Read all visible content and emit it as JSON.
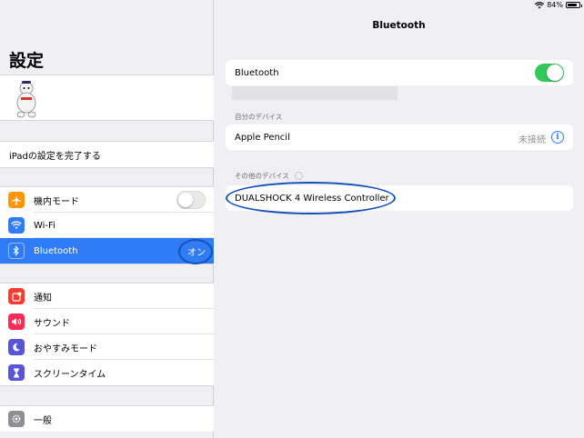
{
  "status_bar": {
    "battery": "84%",
    "battery_level": 0.84
  },
  "sidebar": {
    "title": "設定",
    "setup_prompt": "iPadの設定を完了する",
    "items_network": [
      {
        "label": "機内モード",
        "icon": "airplane-icon",
        "color": "#ff9500"
      },
      {
        "label": "Wi-Fi",
        "icon": "wifi-icon",
        "color": "#2f7cf6"
      },
      {
        "label": "Bluetooth",
        "icon": "bluetooth-icon",
        "color": "#2f7cf6",
        "value": "オン"
      }
    ],
    "items_notify": [
      {
        "label": "通知",
        "icon": "notifications-icon",
        "color": "#ff3b30"
      },
      {
        "label": "サウンド",
        "icon": "sound-icon",
        "color": "#ff2d55"
      },
      {
        "label": "おやすみモード",
        "icon": "moon-icon",
        "color": "#5856d6"
      },
      {
        "label": "スクリーンタイム",
        "icon": "hourglass-icon",
        "color": "#5856d6"
      }
    ],
    "items_general": [
      {
        "label": "一般",
        "icon": "gear-icon",
        "color": "#8e8e93"
      }
    ]
  },
  "detail": {
    "title": "Bluetooth",
    "bluetooth_label": "Bluetooth",
    "bluetooth_on": true,
    "my_devices_header": "自分のデバイス",
    "my_devices": [
      {
        "name": "Apple Pencil",
        "status": "未接続"
      }
    ],
    "other_devices_header": "その他のデバイス",
    "other_devices": [
      {
        "name": "DUALSHOCK 4 Wireless Controller"
      }
    ]
  },
  "colors": {
    "accent": "#2f7cf6",
    "toggle_on": "#34c759",
    "annotation": "#1550b8"
  }
}
